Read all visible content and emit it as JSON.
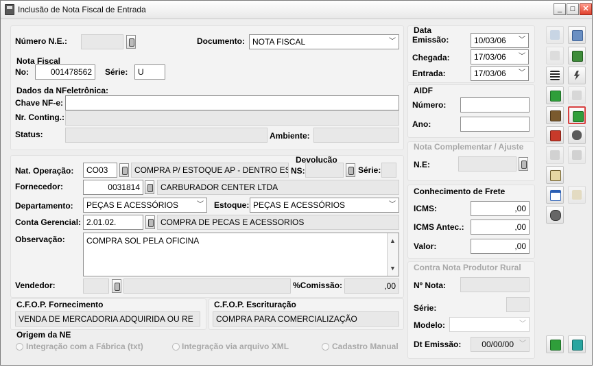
{
  "window": {
    "title": "Inclusão de Nota Fiscal de Entrada",
    "min_glyph": "_",
    "max_glyph": "□",
    "close_glyph": "✕"
  },
  "header": {
    "numero_ne_label": "Número N.E.:",
    "numero_ne_value": "",
    "documento_label": "Documento:",
    "documento_value": "NOTA FISCAL"
  },
  "nota_fiscal": {
    "title": "Nota Fiscal",
    "no_label": "No:",
    "no_value": "001478562",
    "serie_label": "Série:",
    "serie_value": "U"
  },
  "nfe": {
    "title": "Dados da NFeletrônica:",
    "chave_label": "Chave NF-e:",
    "chave_value": "",
    "conting_label": "Nr. Conting.:",
    "conting_value": "",
    "status_label": "Status:",
    "status_value": "",
    "ambiente_label": "Ambiente:",
    "ambiente_value": ""
  },
  "operacao": {
    "nat_label": "Nat. Operação:",
    "nat_code": "CO03",
    "nat_desc": "COMPRA P/ ESTOQUE AP - DENTRO ESTADO",
    "devolucao_label": "Devolução",
    "ns_label": "NS:",
    "ns_value": "",
    "serie_label": "Série:",
    "serie_value": "",
    "fornecedor_label": "Fornecedor:",
    "fornecedor_code": "0031814",
    "fornecedor_name": "CARBURADOR  CENTER  LTDA",
    "departamento_label": "Departamento:",
    "departamento_value": "PEÇAS E ACESSÓRIOS",
    "estoque_label": "Estoque:",
    "estoque_value": "PEÇAS E ACESSÓRIOS",
    "conta_label": "Conta Gerencial:",
    "conta_code": "2.01.02.",
    "conta_desc": "COMPRA DE PECAS E ACESSORIOS",
    "obs_label": "Observação:",
    "obs_value": "COMPRA SOL PELA OFICINA",
    "vendedor_label": "Vendedor:",
    "vendedor_code": "",
    "vendedor_name": "",
    "comissao_label": "%Comissão:",
    "comissao_value": ",00"
  },
  "cfop": {
    "fornecimento_label": "C.F.O.P. Fornecimento",
    "fornecimento_value": "VENDA DE MERCADORIA ADQUIRIDA OU RE",
    "escrituracao_label": "C.F.O.P. Escrituração",
    "escrituracao_value": "COMPRA PARA COMERCIALIZAÇÃO"
  },
  "origem": {
    "title": "Origem da NE",
    "options": [
      "Integração com a Fábrica (txt)",
      "Integração via arquivo XML",
      "Cadastro Manual"
    ]
  },
  "data": {
    "title": "Data",
    "emissao_label": "Emissão:",
    "emissao_value": "10/03/06",
    "chegada_label": "Chegada:",
    "chegada_value": "17/03/06",
    "entrada_label": "Entrada:",
    "entrada_value": "17/03/06"
  },
  "aidf": {
    "title": "AIDF",
    "numero_label": "Número:",
    "numero_value": "",
    "ano_label": "Ano:",
    "ano_value": ""
  },
  "complementar": {
    "title": "Nota Complementar / Ajuste",
    "ne_label": "N.E:",
    "ne_value": ""
  },
  "frete": {
    "title": "Conhecimento de Frete",
    "icms_label": "ICMS:",
    "icms_value": ",00",
    "icms_antec_label": "ICMS Antec.:",
    "icms_antec_value": ",00",
    "valor_label": "Valor:",
    "valor_value": ",00"
  },
  "produtor": {
    "title": "Contra Nota Produtor Rural",
    "nota_label": "Nº Nota:",
    "nota_value": "",
    "serie_label": "Série:",
    "serie_value": "",
    "modelo_label": "Modelo:",
    "modelo_value": "",
    "dt_label": "Dt Emissão:",
    "dt_value": "00/00/00"
  },
  "colors": {
    "accent_blue": "#2b5fb3",
    "accent_green": "#2f9e3a",
    "accent_red": "#c83a2a",
    "disabled_text": "#a8a8a8"
  },
  "icons": {
    "side": [
      "insert-row-icon",
      "grid-icon",
      "preview-icon",
      "calculator-icon",
      "list-icon",
      "lightning-icon",
      "books-icon",
      "trash-icon",
      "house-icon",
      "stack-icon",
      "truck-icon",
      "hand-icon",
      "printer-icon",
      "printer2-icon",
      "clipboard-icon",
      "table-edit-icon",
      "folder-icon",
      "network-icon",
      "confirm-icon",
      "exit-icon"
    ]
  }
}
